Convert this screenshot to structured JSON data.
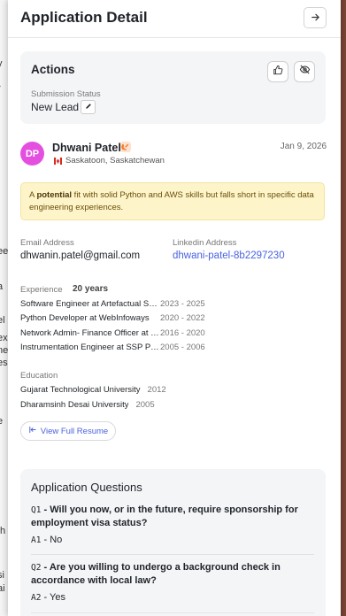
{
  "panel": {
    "title": "Application Detail"
  },
  "actions": {
    "title": "Actions",
    "status_label": "Submission Status",
    "status_value": "New Lead"
  },
  "candidate": {
    "initials": "DP",
    "name": "Dhwani Patel",
    "location": "Saskatoon, Saskatchewan",
    "date": "Jan 9, 2026",
    "avatar_color": "#e44fe0"
  },
  "fit": {
    "prefix": "A ",
    "emphasis": "potential",
    "rest": " fit with solid Python and AWS skills but falls short in specific data engineering experiences."
  },
  "contact": {
    "email_label": "Email Address",
    "email": "dhwanin.patel@gmail.com",
    "linkedin_label": "Linkedin Address",
    "linkedin": "dhwani-patel-8b2297230"
  },
  "experience": {
    "label": "Experience",
    "years": "20 years",
    "items": [
      {
        "title": "Software Engineer at Artefactual Systems",
        "dates": "2023 - 2025"
      },
      {
        "title": "Python Developer at WebInfoways",
        "dates": "2020 - 2022"
      },
      {
        "title": "Network Admin- Finance Officer at Bank",
        "dates": "2016 - 2020"
      },
      {
        "title": "Instrumentation Engineer at SSP Pvt Ltd",
        "dates": "2005 - 2006"
      }
    ]
  },
  "education": {
    "label": "Education",
    "items": [
      {
        "school": "Gujarat Technological University",
        "year": "2012"
      },
      {
        "school": "Dharamsinh Desai University",
        "year": "2005"
      }
    ]
  },
  "resume_button": "View Full Resume",
  "questions": {
    "title": "Application Questions",
    "items": [
      {
        "q_code": "Q1",
        "question": "Will you now, or in the future, require sponsorship for employment visa status?",
        "a_code": "A1",
        "answer": "No"
      },
      {
        "q_code": "Q2",
        "question": "Are you willing to undergo a background check in accordance with local law?",
        "a_code": "A2",
        "answer": "Yes"
      }
    ]
  },
  "background_fragments": [
    "y",
    "•",
    "ee",
    "a",
    "el",
    "ex",
    "ne",
    "es T",
    "e",
    "th",
    "si",
    "ai"
  ]
}
